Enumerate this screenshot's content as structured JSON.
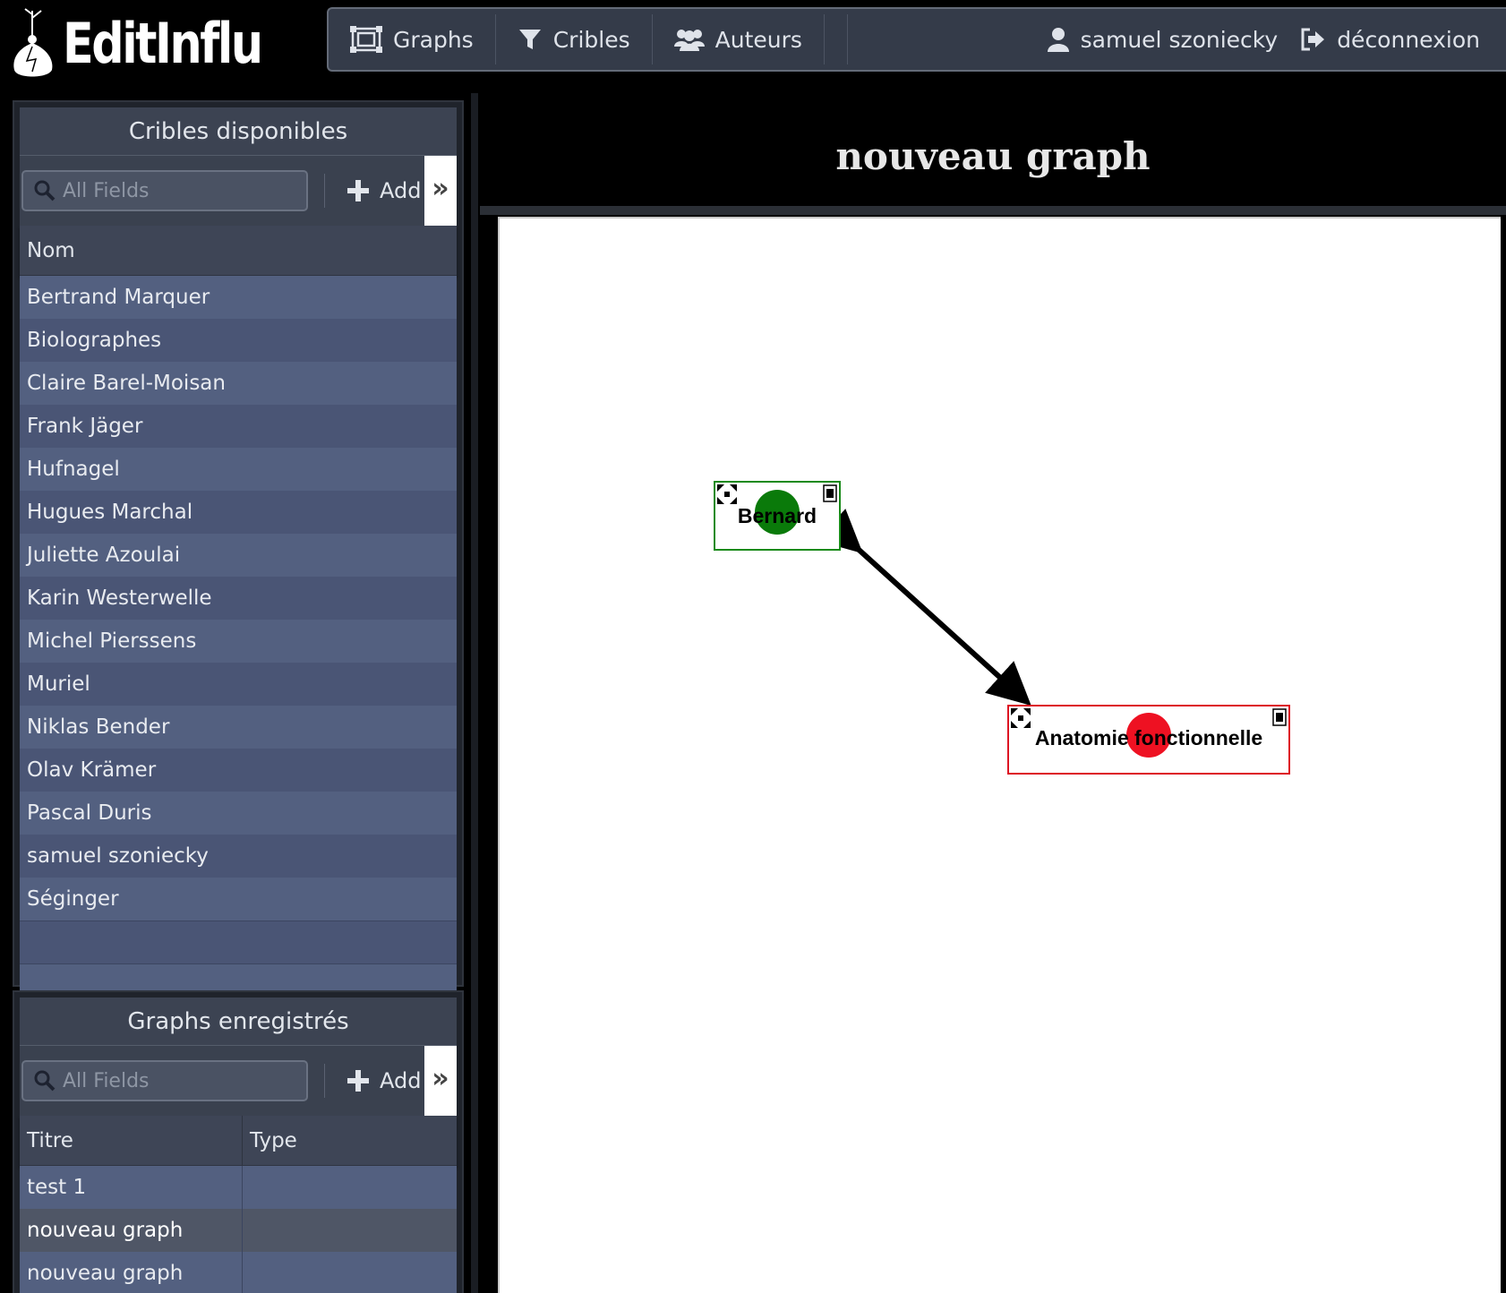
{
  "app": {
    "logo_text": "EditInflu"
  },
  "nav": {
    "graphs": "Graphs",
    "cribles": "Cribles",
    "auteurs": "Auteurs",
    "user": "samuel szoniecky",
    "logout": "déconnexion"
  },
  "cribles_panel": {
    "title": "Cribles disponibles",
    "search_placeholder": "All Fields",
    "add_label": "Add",
    "expand_label": "»",
    "column_nom": "Nom",
    "rows": [
      "Bertrand Marquer",
      "Biolographes",
      "Claire Barel-Moisan",
      "Frank Jäger",
      "Hufnagel",
      "Hugues Marchal",
      "Juliette Azoulai",
      "Karin Westerwelle",
      "Michel Pierssens",
      "Muriel",
      "Niklas Bender",
      "Olav Krämer",
      "Pascal Duris",
      "samuel szoniecky",
      "Séginger"
    ]
  },
  "graphs_panel": {
    "title": "Graphs enregistrés",
    "search_placeholder": "All Fields",
    "add_label": "Add",
    "expand_label": "»",
    "column_titre": "Titre",
    "column_type": "Type",
    "rows": [
      {
        "titre": "test 1",
        "type": "",
        "selected": false
      },
      {
        "titre": "nouveau graph",
        "type": "",
        "selected": true
      },
      {
        "titre": "nouveau graph",
        "type": "",
        "selected": false
      }
    ]
  },
  "graph": {
    "title": "nouveau graph",
    "nodes": [
      {
        "label": "Bernard",
        "color": "#0a7a0a",
        "border": "#1a8a1a"
      },
      {
        "label": "Anatomie fonctionnelle",
        "color": "#ee1122",
        "border": "#dd1122"
      }
    ],
    "link": {
      "from": "Bernard",
      "to": "Anatomie fonctionnelle",
      "bidirectional": true
    }
  }
}
